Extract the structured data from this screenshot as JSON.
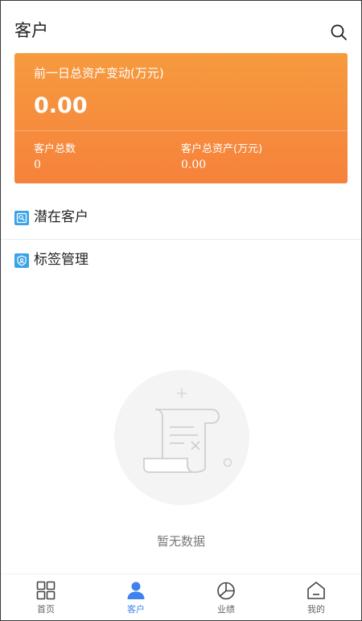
{
  "header": {
    "title": "客户",
    "search_icon": "search-icon"
  },
  "summary_card": {
    "label": "前一日总资产变动(万元)",
    "value": "0.00",
    "stats": [
      {
        "label": "客户总数",
        "value": "0"
      },
      {
        "label": "客户总资产(万元)",
        "value": "0.00"
      }
    ],
    "gradient_colors": [
      "#f69a3e",
      "#f6823c"
    ]
  },
  "menu": {
    "items": [
      {
        "label": "潜在客户",
        "icon": "potential-customer-icon"
      },
      {
        "label": "标签管理",
        "icon": "tag-management-icon"
      }
    ],
    "icon_color": "#3aa3e8"
  },
  "empty_state": {
    "text": "暂无数据",
    "icon": "empty-scroll-icon"
  },
  "tabbar": {
    "active_color": "#3f82ee",
    "inactive_color": "#666666",
    "items": [
      {
        "label": "首页",
        "icon": "grid-icon",
        "active": false
      },
      {
        "label": "客户",
        "icon": "user-icon",
        "active": true
      },
      {
        "label": "业绩",
        "icon": "pie-chart-icon",
        "active": false
      },
      {
        "label": "我的",
        "icon": "home-icon",
        "active": false
      }
    ]
  }
}
